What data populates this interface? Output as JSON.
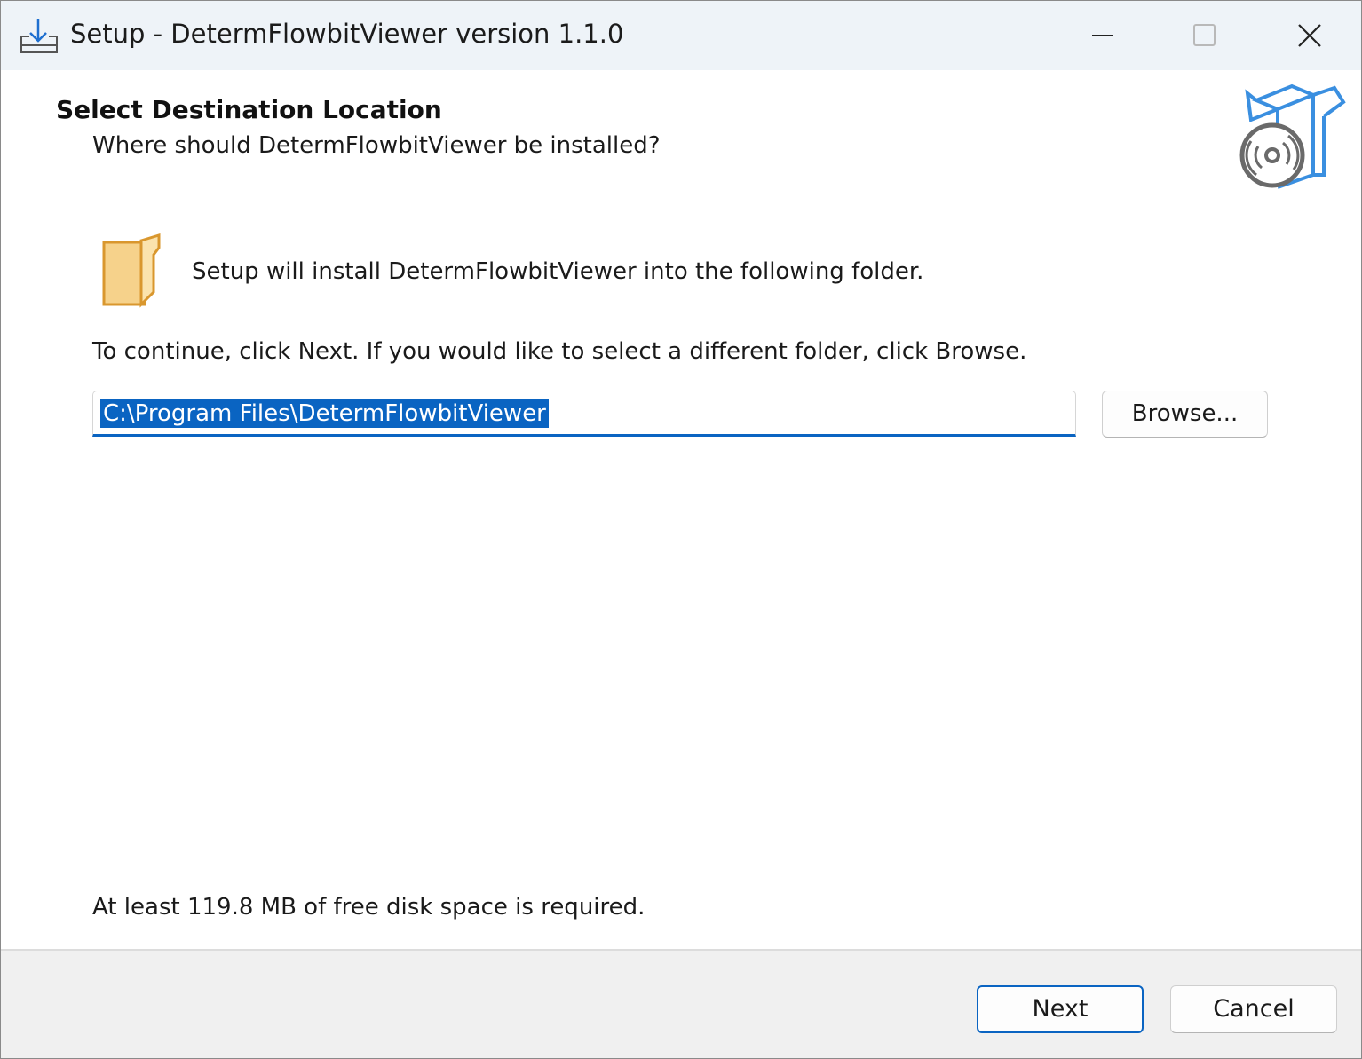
{
  "window": {
    "title": "Setup - DetermFlowbitViewer version 1.1.0"
  },
  "header": {
    "heading": "Select Destination Location",
    "subheading": "Where should DetermFlowbitViewer be installed?"
  },
  "main": {
    "install_text": "Setup will install DetermFlowbitViewer into the following folder.",
    "instruction": "To continue, click Next. If you would like to select a different folder, click Browse.",
    "path_value": "C:\\Program Files\\DetermFlowbitViewer",
    "browse_label": "Browse...",
    "disk_space_text": "At least 119.8 MB of free disk space is required."
  },
  "footer": {
    "next_label": "Next",
    "cancel_label": "Cancel"
  },
  "icons": {
    "app": "install-download-icon",
    "minimize": "minimize-icon",
    "maximize": "maximize-icon",
    "close": "close-icon",
    "wizard": "software-box-disc-icon",
    "folder": "folder-icon"
  },
  "colors": {
    "accent": "#0a64c2",
    "titlebar": "#eef3f8",
    "footer": "#f0f0f0",
    "folder": "#f6d28b"
  }
}
